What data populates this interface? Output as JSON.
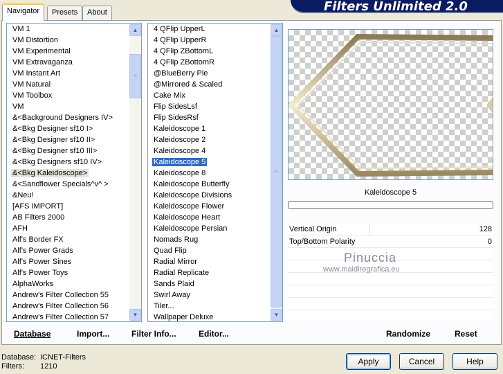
{
  "tabs": [
    "Navigator",
    "Presets",
    "About"
  ],
  "banner": "Filters Unlimited 2.0",
  "categories": [
    "VM 1",
    "VM Distortion",
    "VM Experimental",
    "VM Extravaganza",
    "VM Instant Art",
    "VM Natural",
    "VM Toolbox",
    "VM",
    "&<Background Designers IV>",
    "&<Bkg Designer sf10 I>",
    "&<Bkg Designer sf10 II>",
    "&<Bkg Designer sf10 III>",
    "&<Bkg Designers sf10 IV>",
    "&<Bkg Kaleidoscope>",
    "&<Sandflower Specials^v^ >",
    "&Neu!",
    "[AFS IMPORT]",
    "AB Filters 2000",
    "AFH",
    "Alf's Border FX",
    "Alf's Power Grads",
    "Alf's Power Sines",
    "Alf's Power Toys",
    "AlphaWorks",
    "Andrew's Filter Collection 55",
    "Andrew's Filter Collection 56",
    "Andrew's Filter Collection 57"
  ],
  "selected_category": "&<Bkg Kaleidoscope>",
  "filters": [
    "4 QFlip UpperL",
    "4 QFlip UpperR",
    "4 QFlip ZBottomL",
    "4 QFlip ZBottomR",
    "@BlueBerry Pie",
    "@Mirrored & Scaled",
    "Cake Mix",
    "Flip SidesLsf",
    "Flip SidesRsf",
    "Kaleidoscope 1",
    "Kaleidoscope 2",
    "Kaleidoscope 4",
    "Kaleidoscope 5",
    "Kaleidoscope 8",
    "Kaleidoscope Butterfly",
    "Kaleidoscope Divisions",
    "Kaleidoscope Flower",
    "Kaleidoscope Heart",
    "Kaleidoscope Persian",
    "Nomads Rug",
    "Quad Flip",
    "Radial Mirror",
    "Radial Replicate",
    "Sands Plaid",
    "Swirl Away",
    "Tiler...",
    "Wallpaper Deluxe"
  ],
  "selected_filter": "Kaleidoscope 5",
  "preview_filter_name": "Kaleidoscope 5",
  "params": [
    {
      "label": "Vertical Origin",
      "value": "128"
    },
    {
      "label": "Top/Bottom Polarity",
      "value": "0"
    }
  ],
  "watermark": {
    "line1": "Pinuccia",
    "line2": "www.maidiregrafica.eu"
  },
  "toolbar": {
    "database": "Database",
    "import": "Import...",
    "filter_info": "Filter Info...",
    "editor": "Editor...",
    "randomize": "Randomize",
    "reset": "Reset"
  },
  "status": {
    "database_label": "Database:",
    "database_value": "ICNET-Filters",
    "filters_label": "Filters:",
    "filters_value": "1210"
  },
  "buttons": {
    "apply": "Apply",
    "cancel": "Cancel",
    "help": "Help"
  },
  "colors": {
    "selection": "#316ac5",
    "banner": "#0a1a63",
    "accent_tab": "#ffc83c"
  }
}
